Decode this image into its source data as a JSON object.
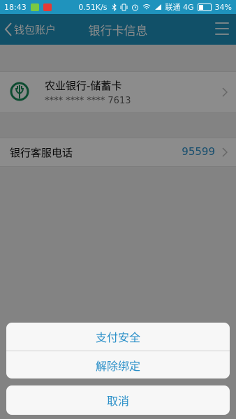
{
  "status_bar": {
    "time": "18:43",
    "speed": "0.51K/s",
    "carrier": "联通 4G",
    "battery": "34%"
  },
  "title_bar": {
    "back_label": "钱包账户",
    "title": "银行卡信息"
  },
  "card": {
    "bank_name": "农业银行-储蓄卡",
    "number": "**** **** **** 7613"
  },
  "service_phone": {
    "label": "银行客服电话",
    "number": "95599"
  },
  "action_sheet": {
    "items": [
      "支付安全",
      "解除绑定"
    ],
    "cancel": "取消"
  },
  "colors": {
    "brand": "#1f93bd",
    "link": "#2a8fc8",
    "bank_green": "#1a8a5a"
  }
}
